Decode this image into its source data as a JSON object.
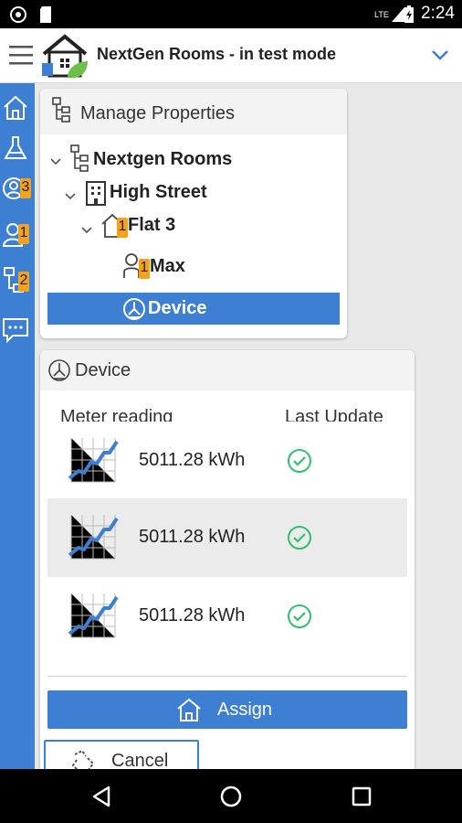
{
  "status_bar": {
    "time": "2:24",
    "network": "LTE"
  },
  "app_bar": {
    "title": "NextGen Rooms - in test mode"
  },
  "sidebar": {
    "badges": [
      "3",
      "1",
      "2"
    ]
  },
  "tree": {
    "header": "Manage Properties",
    "root": "Nextgen Rooms",
    "building": "High Street",
    "flat": "Flat 3",
    "flat_badge": "1",
    "tenant": "Max",
    "tenant_badge": "1",
    "device": "Device"
  },
  "device_panel": {
    "header": "Device",
    "col_reading": "Meter reading",
    "col_update": "Last Update",
    "rows": [
      {
        "reading": "5011.28 kWh"
      },
      {
        "reading": "5011.28 kWh"
      },
      {
        "reading": "5011.28 kWh"
      }
    ],
    "assign_label": "Assign",
    "cancel_label": "Cancel"
  },
  "colors": {
    "accent": "#3d7fd3",
    "badge": "#f3a21a",
    "check": "#2fc26b"
  }
}
